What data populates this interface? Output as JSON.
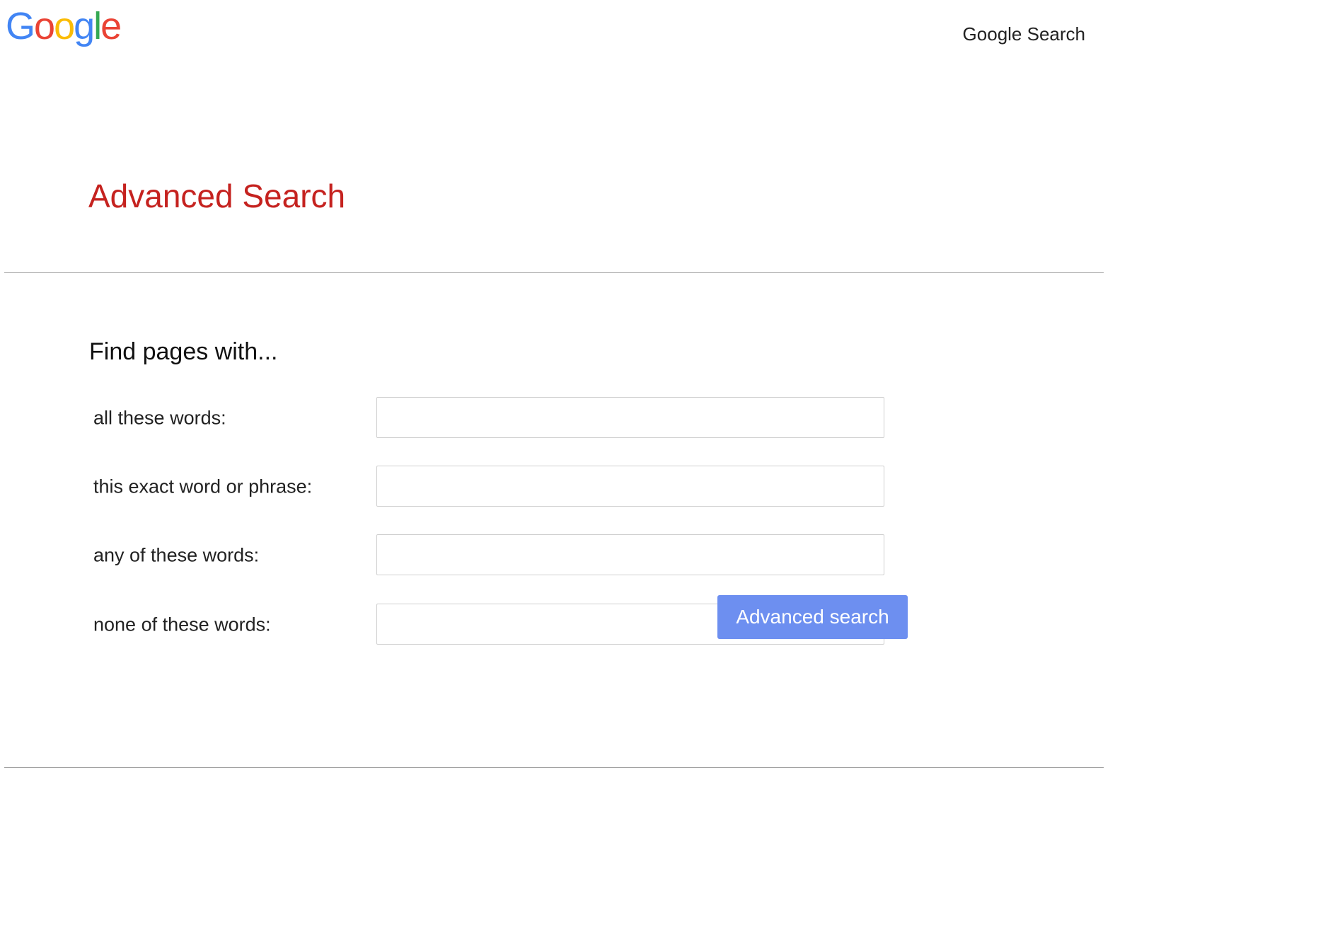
{
  "header": {
    "logo_letters": [
      {
        "char": "G",
        "color": "#4285F4"
      },
      {
        "char": "o",
        "color": "#EA4335"
      },
      {
        "char": "o",
        "color": "#FBBC05"
      },
      {
        "char": "g",
        "color": "#4285F4"
      },
      {
        "char": "l",
        "color": "#34A853"
      },
      {
        "char": "e",
        "color": "#EA4335"
      }
    ],
    "top_link": "Google Search"
  },
  "main": {
    "title": "Advanced Search",
    "section_heading": "Find pages with...",
    "fields": [
      {
        "label": "all these words:",
        "value": ""
      },
      {
        "label": "this exact word or phrase:",
        "value": ""
      },
      {
        "label": "any of these words:",
        "value": ""
      },
      {
        "label": "none of these words:",
        "value": ""
      }
    ],
    "submit_label": "Advanced search"
  },
  "colors": {
    "title": "#c5221f",
    "button": "#6d8ff0",
    "divider": "#9e9e9e"
  }
}
